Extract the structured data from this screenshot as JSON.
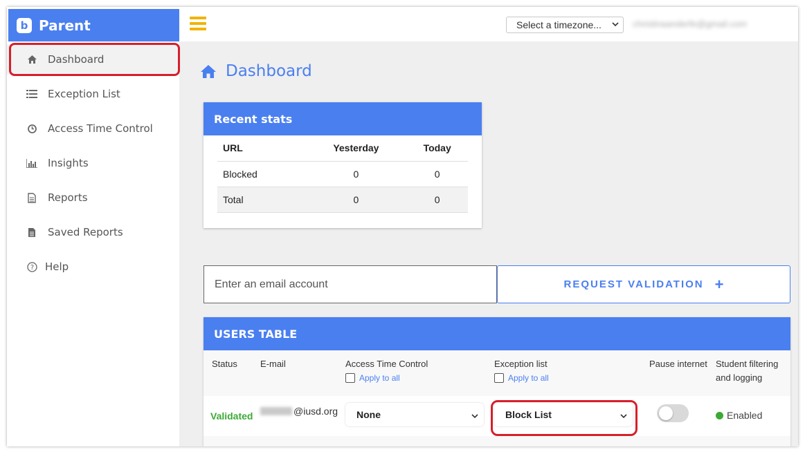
{
  "brand": {
    "logo_letter": "b",
    "name": "Parent"
  },
  "sidebar": {
    "items": [
      {
        "label": "Dashboard",
        "icon": "home-icon"
      },
      {
        "label": "Exception List",
        "icon": "list-icon"
      },
      {
        "label": "Access Time Control",
        "icon": "clock-icon"
      },
      {
        "label": "Insights",
        "icon": "bar-chart-icon"
      },
      {
        "label": "Reports",
        "icon": "document-icon"
      },
      {
        "label": "Saved Reports",
        "icon": "saved-document-icon"
      },
      {
        "label": "Help",
        "icon": "question-icon"
      }
    ]
  },
  "topbar": {
    "timezone_label": "Select a timezone...",
    "user_email": "christinaanderfe@gmail.com"
  },
  "page": {
    "title": "Dashboard"
  },
  "stats": {
    "title": "Recent stats",
    "headers": [
      "URL",
      "Yesterday",
      "Today"
    ],
    "rows": [
      [
        "Blocked",
        "0",
        "0"
      ],
      [
        "Total",
        "0",
        "0"
      ]
    ]
  },
  "email_form": {
    "placeholder": "Enter an email account",
    "button_label": "REQUEST VALIDATION",
    "button_icon": "+"
  },
  "users": {
    "title": "USERS TABLE",
    "headers": {
      "status": "Status",
      "email": "E-mail",
      "access": "Access Time Control",
      "exception": "Exception list",
      "pause": "Pause internet",
      "filtering_line1": "Student filtering",
      "filtering_line2": "and logging"
    },
    "apply_all": "Apply to all",
    "row": {
      "status": "Validated",
      "email_domain": "@iusd.org",
      "access_value": "None",
      "exception_value": "Block List",
      "filtering": "Enabled"
    }
  },
  "colors": {
    "accent": "#4a7ff0",
    "highlight": "#d61f2b",
    "validated": "#3aaa35",
    "menu": "#f0b400"
  }
}
